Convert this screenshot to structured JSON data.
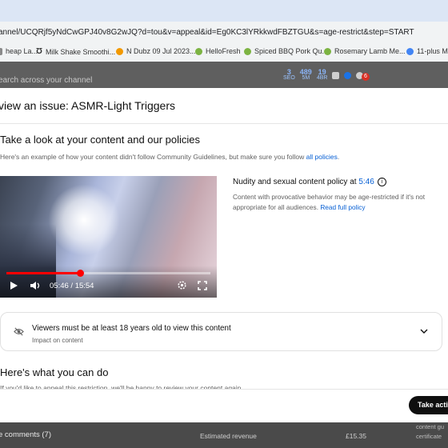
{
  "browser": {
    "url": "annel/UCQRjf5yNdCwGPJ40v8G2wJQ?d=tou&v=appeal&id=Eg0KC3lYRkkwdFBZTGU&s=age-restrict&step=START",
    "bookmarks": [
      {
        "label": "heap La...",
        "color": "#8a8a8a"
      },
      {
        "label": "Milk Shake Smoothi...",
        "color": "#222222"
      },
      {
        "label": "N Dubz 09 Jul 2023...",
        "color": "#f29900"
      },
      {
        "label": "HelloFresh",
        "color": "#7cb342"
      },
      {
        "label": "Spiced BBQ Pork Qu...",
        "color": "#7cb342"
      },
      {
        "label": "Rosemary Lamb Me...",
        "color": "#7cb342"
      },
      {
        "label": "11-plus M",
        "color": "#4285f4"
      }
    ]
  },
  "studio_header": {
    "search_placeholder": "earch across your channel",
    "stats": [
      {
        "value": "3",
        "label": "SEO"
      },
      {
        "value": "489",
        "label": "5M"
      },
      {
        "value": "19",
        "label": "4BR"
      }
    ],
    "notification_count": "6"
  },
  "modal": {
    "title": "view an issue: ASMR-Light Triggers",
    "section_title": "Take a look at your content and our policies",
    "section_sub_prefix": "Here's an example of how your content didn't follow Community Guidelines, but make sure you follow ",
    "section_sub_link": "all policies",
    "section_sub_suffix": ".",
    "video": {
      "current_time": "05:46",
      "duration": "15:54",
      "time_display": "05:46 / 15:54",
      "progress": 0.362
    },
    "policy": {
      "title_prefix": "Nudity and sexual content policy at ",
      "timestamp": "5:46",
      "description": "Content with provocative behavior may be age-restricted if it's not appropriate for all audiences. ",
      "read_link": "Read full policy"
    },
    "restriction": {
      "title": "Viewers must be at least 18 years old to view this content",
      "subtitle": "Impact on content"
    },
    "what_to_do_title": "Here's what you can do",
    "what_to_do_text": "If you'd like to appeal this restriction, we'll be happy to review your content again.",
    "take_action_label": "Take actio"
  },
  "underlay": {
    "comments": "e comments (7)",
    "revenue_label": "Estimated revenue",
    "revenue_value": "£15.35",
    "side_lines": [
      "content gu",
      "certificate"
    ]
  }
}
